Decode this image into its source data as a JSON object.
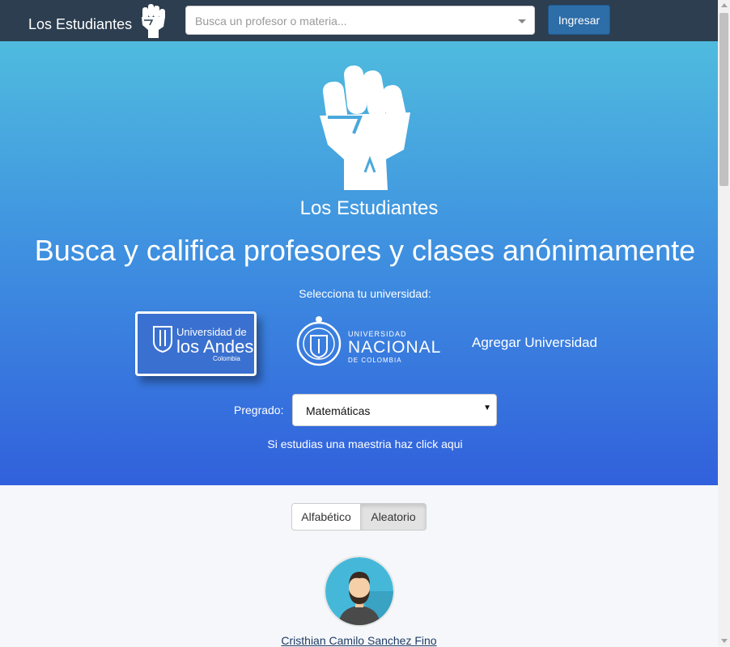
{
  "navbar": {
    "brand": "Los Estudiantes",
    "search_placeholder": "Busca un profesor o materia...",
    "login_label": "Ingresar"
  },
  "hero": {
    "title": "Los Estudiantes",
    "headline": "Busca y califica profesores y clases anónimamente",
    "select_prompt": "Selecciona tu universidad:",
    "universities": [
      {
        "line1": "Universidad de",
        "line2": "los Andes",
        "line3": "Colombia"
      },
      {
        "line1": "UNIVERSIDAD",
        "line2": "NACIONAL",
        "line3": "DE COLOMBIA"
      }
    ],
    "add_university": "Agregar Universidad",
    "pregrado_label": "Pregrado:",
    "pregrado_value": "Matemáticas",
    "maestria_link": "Si estudias una maestria haz click aqui"
  },
  "sort": {
    "alpha": "Alfabético",
    "random": "Aleatorio"
  },
  "professor": {
    "name": "Cristhian Camilo Sanchez Fino"
  },
  "colors": {
    "navbar": "#2c3e50",
    "hero_top": "#4fbbde",
    "hero_bottom": "#3160dc",
    "button": "#2d6da8"
  }
}
